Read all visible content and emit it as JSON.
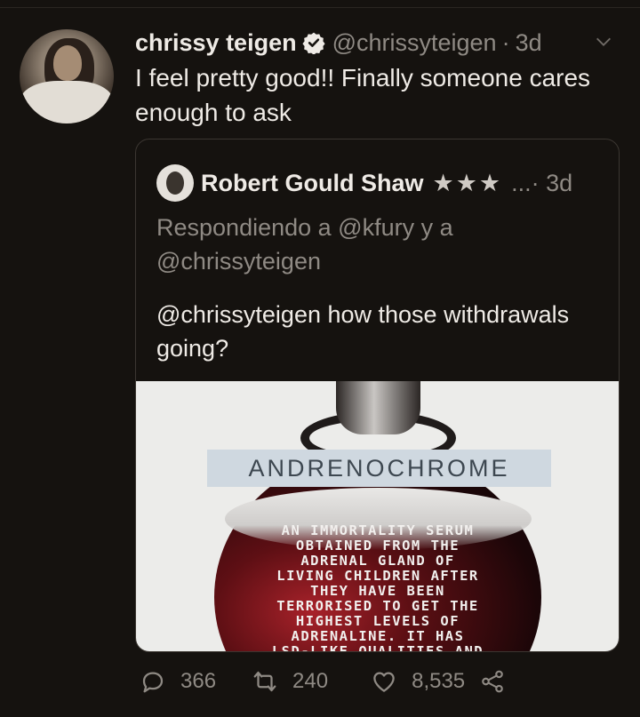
{
  "tweet": {
    "author_name": "chrissy teigen",
    "handle": "@chrissyteigen",
    "separator": "·",
    "time": "3d",
    "text": "I feel pretty good!! Finally someone cares enough to ask"
  },
  "quote": {
    "author_name": "Robert Gould Shaw",
    "stars": "★★★",
    "meta": "...· 3d",
    "replying_to": "Respondiendo a @kfury y a @chrissyteigen",
    "text": "@chrissyteigen how those withdrawals going?",
    "image": {
      "title": "ANDRENOCHROME",
      "caption": "AN IMMORTALITY SERUM\nOBTAINED FROM THE\nADRENAL GLAND OF\nLIVING CHILDREN AFTER\nTHEY HAVE BEEN\nTERRORISED TO GET THE\nHIGHEST LEVELS OF\nADRENALINE. IT HAS\nLSD-LIKE QUALITIES AND"
    }
  },
  "actions": {
    "replies": "366",
    "retweets": "240",
    "likes": "8,535"
  },
  "colors": {
    "background": "#15120f",
    "text": "#efebe6",
    "muted": "#8f8a84",
    "border": "#3b3631"
  },
  "icons": [
    "verified-icon",
    "chevron-down-icon",
    "reply-icon",
    "retweet-icon",
    "like-icon",
    "share-icon"
  ]
}
